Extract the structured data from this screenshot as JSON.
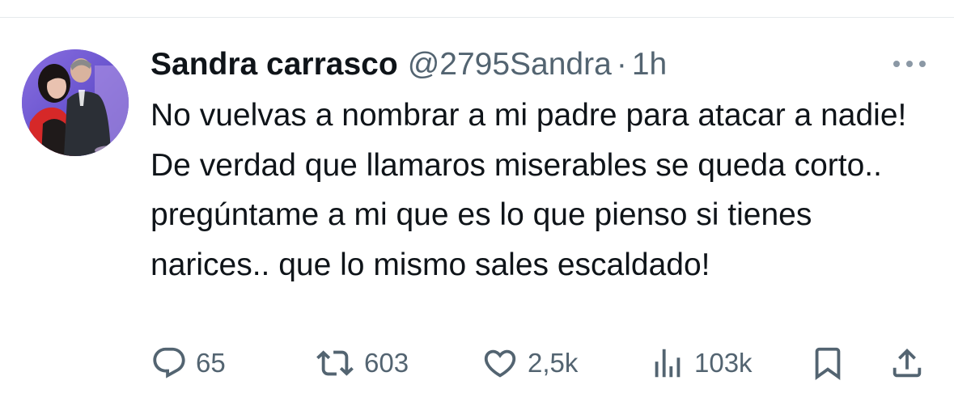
{
  "tweet": {
    "display_name": "Sandra carrasco",
    "handle": "@2795Sandra",
    "separator": "·",
    "timestamp": "1h",
    "text": "No vuelvas a nombrar a mi padre para atacar a nadie! De verdad que llamaros miserables se queda corto.. pregúntame a mi que es lo que pienso si tienes narices.. que lo mismo sales escaldado!"
  },
  "actions": {
    "reply": {
      "icon": "reply-icon",
      "count": "65"
    },
    "retweet": {
      "icon": "retweet-icon",
      "count": "603"
    },
    "like": {
      "icon": "heart-icon",
      "count": "2,5k"
    },
    "views": {
      "icon": "views-icon",
      "count": "103k"
    },
    "bookmark": {
      "icon": "bookmark-icon"
    },
    "share": {
      "icon": "share-icon"
    }
  },
  "colors": {
    "text_primary": "#0f1419",
    "text_secondary": "#536471",
    "divider": "#e6e9ec",
    "avatar_background": "#6f5fd0"
  }
}
